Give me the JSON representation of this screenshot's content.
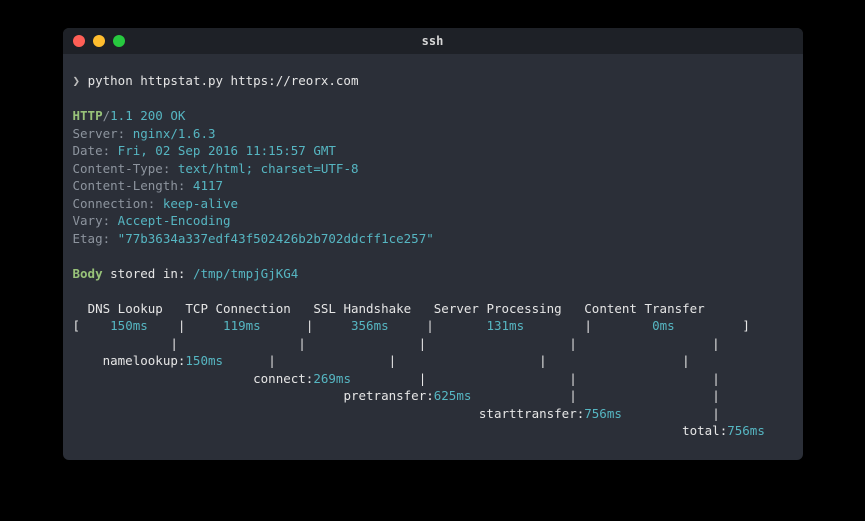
{
  "window": {
    "title": "ssh"
  },
  "prompt": {
    "symbol": "❯",
    "command": "python httpstat.py https://reorx.com"
  },
  "response": {
    "protocol": "HTTP",
    "version_status": "1.1 200 OK",
    "headers": [
      {
        "name": "Server",
        "value": "nginx/1.6.3"
      },
      {
        "name": "Date",
        "value": "Fri, 02 Sep 2016 11:15:57 GMT"
      },
      {
        "name": "Content-Type",
        "value": "text/html; charset=UTF-8"
      },
      {
        "name": "Content-Length",
        "value": "4117"
      },
      {
        "name": "Connection",
        "value": "keep-alive"
      },
      {
        "name": "Vary",
        "value": "Accept-Encoding"
      },
      {
        "name": "Etag",
        "value": "\"77b3634a337edf43f502426b2b702ddcff1ce257\""
      }
    ]
  },
  "body": {
    "label": "Body",
    "text": "stored in: ",
    "path": "/tmp/tmpjGjKG4"
  },
  "timing": {
    "columns": [
      "DNS Lookup",
      "TCP Connection",
      "SSL Handshake",
      "Server Processing",
      "Content Transfer"
    ],
    "values": [
      "150ms",
      "119ms",
      "356ms",
      "131ms",
      "0ms"
    ],
    "waterfall": [
      {
        "label": "namelookup:",
        "value": "150ms"
      },
      {
        "label": "connect:",
        "value": "269ms"
      },
      {
        "label": "pretransfer:",
        "value": "625ms"
      },
      {
        "label": "starttransfer:",
        "value": "756ms"
      },
      {
        "label": "total:",
        "value": "756ms"
      }
    ]
  }
}
